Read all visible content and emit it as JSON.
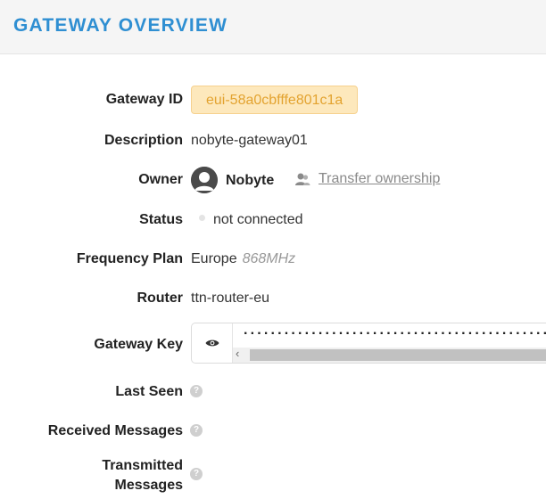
{
  "header": {
    "title": "GATEWAY OVERVIEW"
  },
  "fields": {
    "gateway_id": {
      "label": "Gateway ID",
      "value": "eui-58a0cbfffe801c1a"
    },
    "description": {
      "label": "Description",
      "value": "nobyte-gateway01"
    },
    "owner": {
      "label": "Owner",
      "name": "Nobyte",
      "transfer_link": "Transfer ownership"
    },
    "status": {
      "label": "Status",
      "value": "not connected"
    },
    "frequency_plan": {
      "label": "Frequency Plan",
      "region": "Europe",
      "band": "868MHz"
    },
    "router": {
      "label": "Router",
      "value": "ttn-router-eu"
    },
    "gateway_key": {
      "label": "Gateway Key",
      "masked": "······························································"
    },
    "last_seen": {
      "label": "Last Seen",
      "help": "?"
    },
    "received_messages": {
      "label": "Received Messages",
      "help": "?"
    },
    "transmitted_messages": {
      "label_line1": "Transmitted",
      "label_line2": "Messages",
      "help": "?"
    }
  },
  "colors": {
    "accent": "#2f8fd2",
    "badge_bg": "#fde8bc",
    "badge_text": "#e3a330",
    "status_dot": "#e4e4e4"
  },
  "icons": {
    "avatar": "user-avatar-icon",
    "transfer": "users-icon",
    "reveal": "eye-icon",
    "help": "question-circle-icon"
  }
}
